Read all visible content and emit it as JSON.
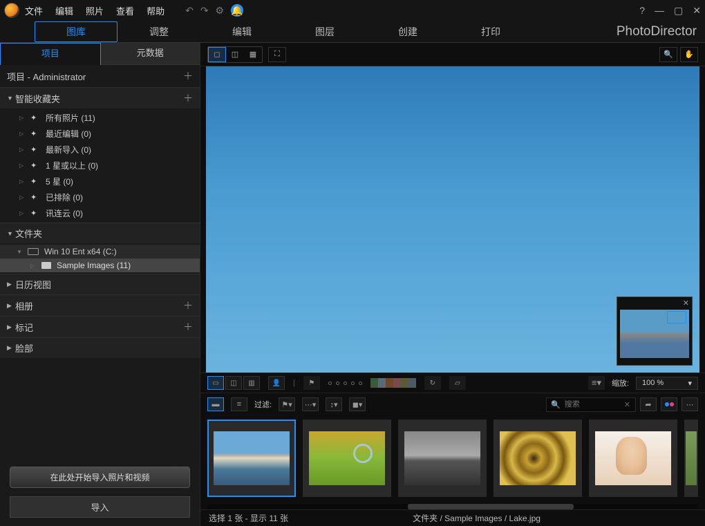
{
  "menu": {
    "file": "文件",
    "edit": "编辑",
    "photo": "照片",
    "view": "查看",
    "help": "帮助"
  },
  "brand": "PhotoDirector",
  "modes": {
    "library": "图库",
    "adjust": "调整",
    "edit": "编辑",
    "layer": "图层",
    "create": "创建",
    "print": "打印"
  },
  "side": {
    "project_tab": "项目",
    "metadata_tab": "元数据",
    "project_label": "项目 - Administrator"
  },
  "smart": {
    "title": "智能收藏夹",
    "items": [
      {
        "label": "所有照片 (11)"
      },
      {
        "label": "最近编辑 (0)"
      },
      {
        "label": "最新导入 (0)"
      },
      {
        "label": "1 星或以上 (0)"
      },
      {
        "label": "5 星 (0)"
      },
      {
        "label": "已排除 (0)"
      },
      {
        "label": "讯连云 (0)"
      }
    ]
  },
  "folders": {
    "title": "文件夹",
    "drive": "Win 10 Ent x64 (C:)",
    "sub": "Sample Images (11)"
  },
  "sections": {
    "calendar": "日历视图",
    "album": "相册",
    "tag": "标记",
    "face": "脸部"
  },
  "hint": "在此处开始导入照片和视频",
  "import_btn": "导入",
  "zoom": {
    "label": "缩放:",
    "value": "100 %"
  },
  "filter": {
    "label": "过滤:"
  },
  "search": {
    "placeholder": "搜索"
  },
  "status": {
    "selection": "选择 1 张 - 显示 11 张",
    "folder_label": "文件夹",
    "path": "/ Sample Images / Lake.jpg"
  },
  "swatches": [
    "#3a5a3a",
    "#5a6a7a",
    "#6a4a2a",
    "#7a4a4a",
    "#5a5a3a",
    "#4a5a6a"
  ]
}
